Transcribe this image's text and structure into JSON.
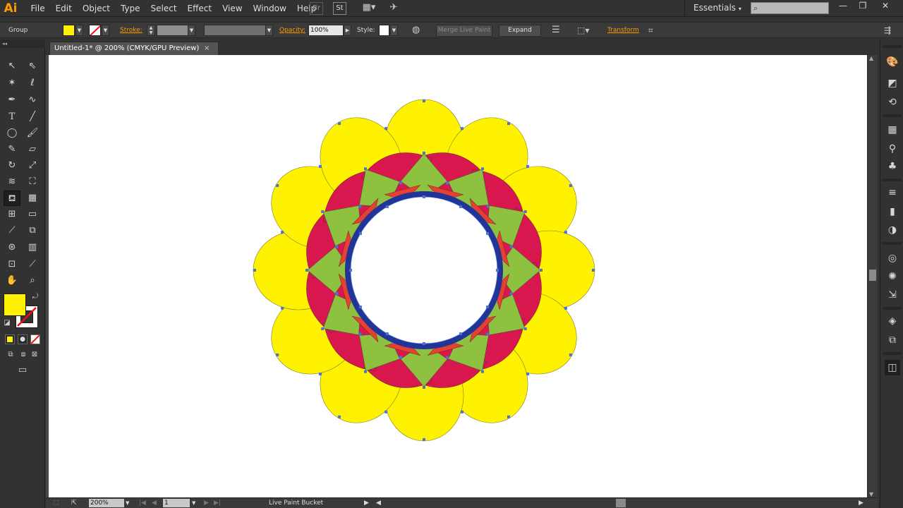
{
  "app": {
    "logo": "Ai",
    "accent": "#FF9A00"
  },
  "menu": [
    "File",
    "Edit",
    "Object",
    "Type",
    "Select",
    "Effect",
    "View",
    "Window",
    "Help"
  ],
  "menubar_buttons": {
    "bridge": "Br",
    "stock": "St"
  },
  "workspace": {
    "label": "Essentials",
    "search_placeholder": ""
  },
  "window_controls": {
    "minimize": "—",
    "restore": "❐",
    "close": "✕"
  },
  "control_bar": {
    "selection_type": "Group",
    "fill_color": "#FFF200",
    "stroke_label": "Stroke:",
    "opacity_label": "Opacity:",
    "opacity_value": "100%",
    "style_label": "Style:",
    "merge_live_paint": "Merge Live Paint",
    "expand": "Expand",
    "transform": "Transform"
  },
  "document": {
    "tab_title": "Untitled-1* @ 200% (CMYK/GPU Preview)",
    "close": "×"
  },
  "status": {
    "zoom": "200%",
    "page": "1",
    "tool": "Live Paint Bucket"
  },
  "swatches": {
    "fill": "#FFF200"
  },
  "artwork": {
    "colors": {
      "yellow": "#FFF200",
      "crimson": "#D8174F",
      "green": "#8DC13F",
      "red": "#E84030",
      "navy": "#223496",
      "anchor": "#4A74D4"
    },
    "petal_count": 12
  }
}
